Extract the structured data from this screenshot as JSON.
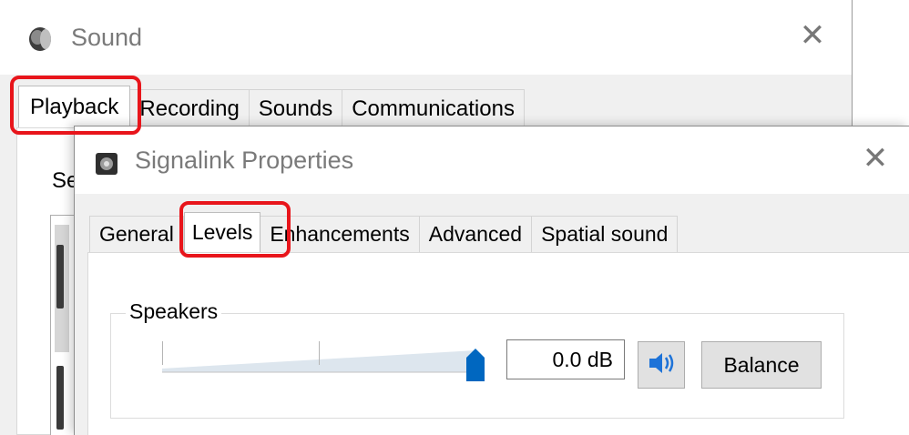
{
  "sound_window": {
    "title": "Sound",
    "icon": "speaker-icon",
    "close_glyph": "✕",
    "tabs": [
      {
        "label": "Playback",
        "active": true
      },
      {
        "label": "Recording",
        "active": false
      },
      {
        "label": "Sounds",
        "active": false
      },
      {
        "label": "Communications",
        "active": false
      }
    ],
    "body_label": "Se"
  },
  "properties_dialog": {
    "title": "Signalink Properties",
    "icon": "device-icon",
    "close_glyph": "✕",
    "tabs": [
      {
        "label": "General",
        "active": false
      },
      {
        "label": "Levels",
        "active": true
      },
      {
        "label": "Enhancements",
        "active": false
      },
      {
        "label": "Advanced",
        "active": false
      },
      {
        "label": "Spatial sound",
        "active": false
      }
    ],
    "speakers": {
      "group_label": "Speakers",
      "level_db": "0.0 dB",
      "slider_level": 1.0,
      "mute_icon": "volume-icon",
      "balance_label": "Balance"
    }
  },
  "colors": {
    "annotation": "#e8151b",
    "slider_thumb": "#0067c0",
    "volume_icon": "#1e73d8"
  }
}
